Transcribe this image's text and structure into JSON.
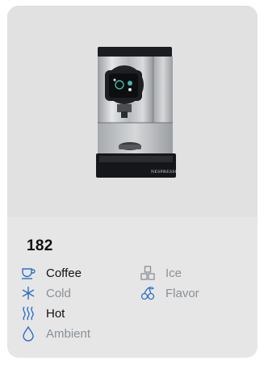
{
  "product": {
    "title": "182"
  },
  "attributes": [
    {
      "label": "Coffee",
      "icon": "coffee-cup-icon",
      "active": true
    },
    {
      "label": "Ice",
      "icon": "ice-cubes-icon",
      "active": false
    },
    {
      "label": "Cold",
      "icon": "snowflake-icon",
      "active": false
    },
    {
      "label": "Flavor",
      "icon": "flavor-cherries-icon",
      "active": false
    },
    {
      "label": "Hot",
      "icon": "steam-icon",
      "active": true
    },
    {
      "label": "Ambient",
      "icon": "water-drop-icon",
      "active": false
    }
  ],
  "machine_brand": "NESPRESSO",
  "colors": {
    "active_icon": "#2f6fc6",
    "inactive_icon": "#8a9098",
    "active_text": "#111111",
    "inactive_text": "#8a9098",
    "card_bg": "#e6e6e6"
  }
}
